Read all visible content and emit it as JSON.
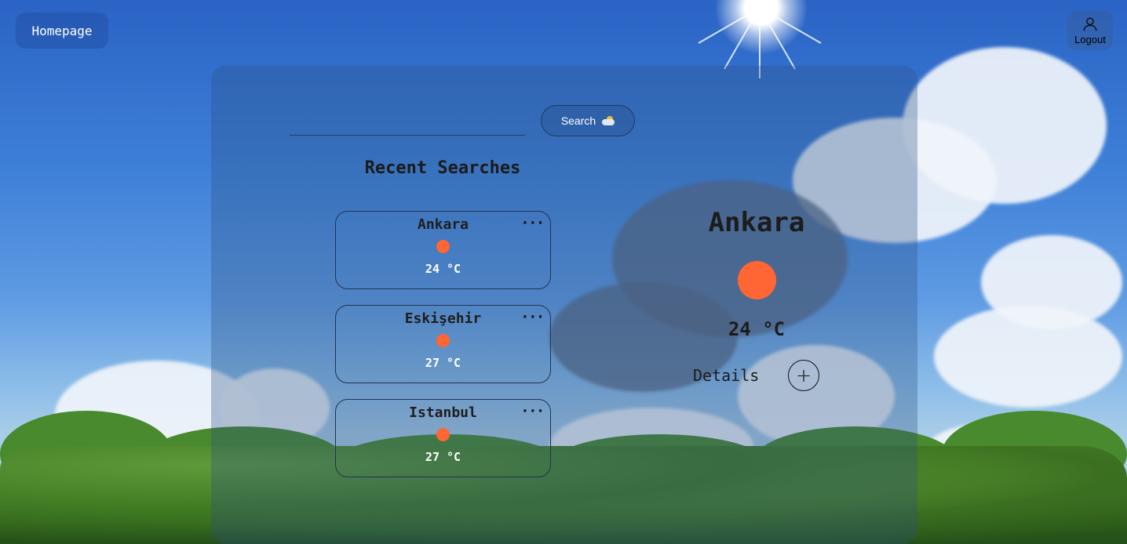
{
  "nav": {
    "home_label": "Homepage",
    "logout_label": "Logout"
  },
  "search": {
    "button_label": "Search",
    "value": ""
  },
  "recent": {
    "title": "Recent Searches",
    "items": [
      {
        "city": "Ankara",
        "temp": "24 °C",
        "menu": "···"
      },
      {
        "city": "Eskişehir",
        "temp": "27 °C",
        "menu": "···"
      },
      {
        "city": "Istanbul",
        "temp": "27 °C",
        "menu": "···"
      }
    ]
  },
  "current": {
    "city": "Ankara",
    "temp": "24 °C",
    "details_label": "Details",
    "details_button": "+"
  },
  "icons": {
    "weather": "sun-icon",
    "search": "cloud-sun-icon",
    "user": "user-icon",
    "more": "ellipsis-icon",
    "add": "plus-icon"
  },
  "colors": {
    "sun_dot": "#ff6633"
  }
}
